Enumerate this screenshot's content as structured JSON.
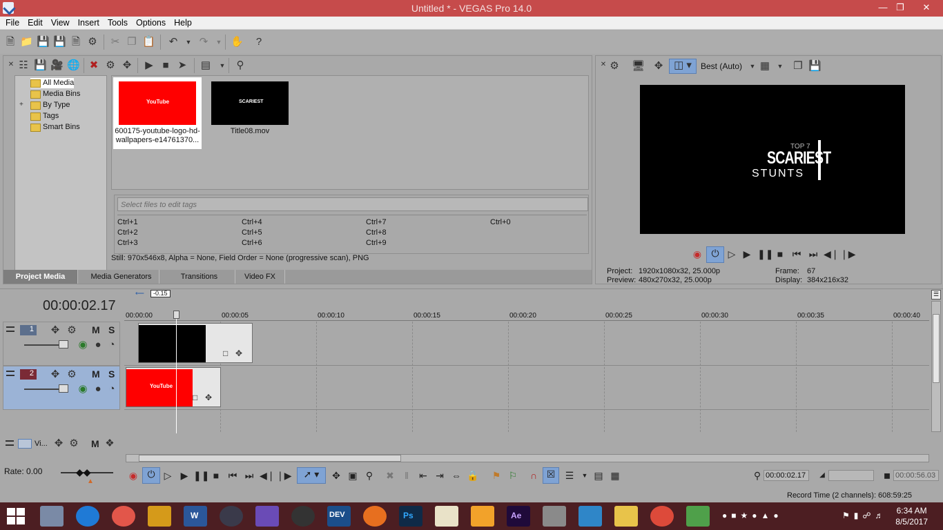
{
  "window": {
    "title": "Untitled * - VEGAS Pro 14.0"
  },
  "menu": [
    "File",
    "Edit",
    "View",
    "Insert",
    "Tools",
    "Options",
    "Help"
  ],
  "media": {
    "tree": [
      "All Media",
      "Media Bins",
      "By Type",
      "Tags",
      "Smart Bins"
    ],
    "tree_expand": "+",
    "items": [
      {
        "name_line1": "600175-youtube-logo-hd-",
        "name_line2": "wallpapers-e14761370...",
        "thumb_text": "YouTube",
        "thumb_color": "#ff0000"
      },
      {
        "name_line1": "Title08.mov",
        "thumb_text": "SCARIEST",
        "thumb_color": "#000000"
      }
    ],
    "tag_placeholder": "Select files to edit tags",
    "shortcuts": [
      "Ctrl+1",
      "Ctrl+2",
      "Ctrl+3",
      "Ctrl+4",
      "Ctrl+5",
      "Ctrl+6",
      "Ctrl+7",
      "Ctrl+8",
      "Ctrl+9",
      "Ctrl+0"
    ],
    "status": "Still: 970x546x8, Alpha = None, Field Order = None (progressive scan), PNG",
    "tabs": [
      "Project Media",
      "Media Generators",
      "Transitions",
      "Video FX"
    ]
  },
  "preview": {
    "quality": "Best (Auto)",
    "frame_text": {
      "top": "TOP 7",
      "main": "SCARIEST",
      "sub": "STUNTS"
    },
    "project_label": "Project:",
    "project_value": "1920x1080x32, 25.000p",
    "preview_label": "Preview:",
    "preview_value": "480x270x32, 25.000p",
    "frame_label": "Frame:",
    "frame_value": "67",
    "display_label": "Display:",
    "display_value": "384x216x32"
  },
  "timeline": {
    "timecode": "00:00:02.17",
    "offset_badge": "-0.15",
    "ruler": [
      "00:00:00",
      "00:00:05",
      "00:00:10",
      "00:00:15",
      "00:00:20",
      "00:00:25",
      "00:00:30",
      "00:00:35",
      "00:00:40"
    ],
    "tracks": [
      {
        "number": "1",
        "m": "M",
        "s": "S"
      },
      {
        "number": "2",
        "m": "M",
        "s": "S"
      }
    ],
    "bus_label": "Vi...",
    "bus_m": "M",
    "clip_youtube_text": "YouTube",
    "rate": "Rate: 0.00",
    "cursor_time": "00:00:02.17",
    "end_time": "00:00:56.03",
    "record_time": "Record Time (2 channels): 608:59:25"
  },
  "taskbar": {
    "time": "6:34 AM",
    "date": "8/5/2017",
    "app_labels": {
      "word": "W",
      "dev": "DEV",
      "ps": "Ps",
      "ae": "Ae"
    }
  }
}
